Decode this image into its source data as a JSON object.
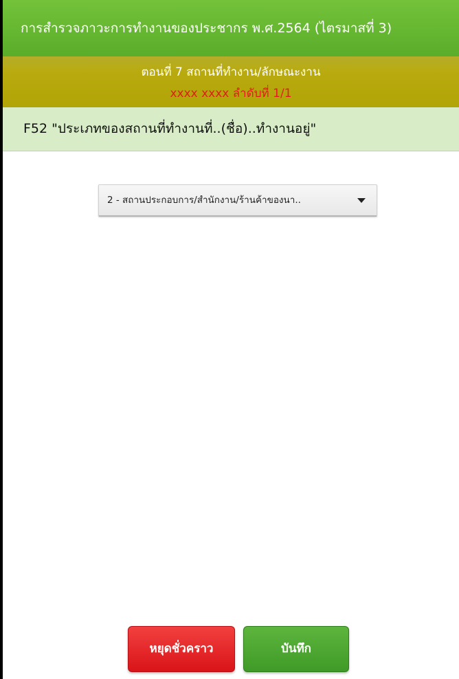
{
  "header": {
    "title": "การสำรวจภาวะการทำงานของประชากร พ.ศ.2564 (ไตรมาสที่ 3)"
  },
  "section": {
    "title": "ตอนที่ 7  สถานที่ทำงาน/ลักษณะงาน",
    "subtitle": "xxxx xxxx ลำดับที่ 1/1"
  },
  "question": {
    "text": "F52 \"ประเภทของสถานที่ทำงานที่..(ชื่อ)..ทำงานอยู่\""
  },
  "answer": {
    "selected": "2 - สถานประกอบการ/สำนักงาน/ร้านค้าของนา.."
  },
  "buttons": {
    "pause_label": "หยุดชั่วคราว",
    "save_label": "บันทึก"
  },
  "colors": {
    "header_green": "#5aad2a",
    "section_olive": "#b1a407",
    "subtitle_red": "#e31b1b",
    "question_bg": "#d8edc7",
    "pause_red": "#d91419",
    "save_green": "#3f9a27"
  },
  "icons": {
    "dropdown": "caret-down-icon"
  }
}
